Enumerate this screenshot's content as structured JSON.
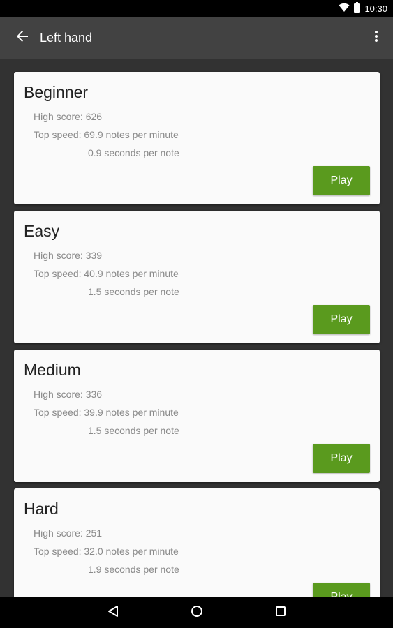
{
  "status_bar": {
    "time": "10:30",
    "icons": [
      "wifi-icon",
      "battery-icon"
    ]
  },
  "app_bar": {
    "title": "Left hand",
    "back_icon": "arrow-back-icon",
    "menu_icon": "more-vert-icon"
  },
  "levels": [
    {
      "title": "Beginner",
      "high_score": "High score: 626",
      "top_speed": "Top speed: 69.9 notes per minute",
      "seconds_per_note": "0.9 seconds per note",
      "play_label": "Play"
    },
    {
      "title": "Easy",
      "high_score": "High score: 339",
      "top_speed": "Top speed: 40.9 notes per minute",
      "seconds_per_note": "1.5 seconds per note",
      "play_label": "Play"
    },
    {
      "title": "Medium",
      "high_score": "High score: 336",
      "top_speed": "Top speed: 39.9 notes per minute",
      "seconds_per_note": "1.5 seconds per note",
      "play_label": "Play"
    },
    {
      "title": "Hard",
      "high_score": "High score: 251",
      "top_speed": "Top speed: 32.0 notes per minute",
      "seconds_per_note": "1.9 seconds per note",
      "play_label": "Play"
    }
  ],
  "nav_bar": {
    "icons": [
      "back-triangle-icon",
      "home-circle-icon",
      "recents-square-icon"
    ]
  },
  "colors": {
    "app_bar": "#424242",
    "background": "#323232",
    "card": "#fafafa",
    "accent_button": "#5a9a1e",
    "secondary_text": "#8a8a8a"
  }
}
